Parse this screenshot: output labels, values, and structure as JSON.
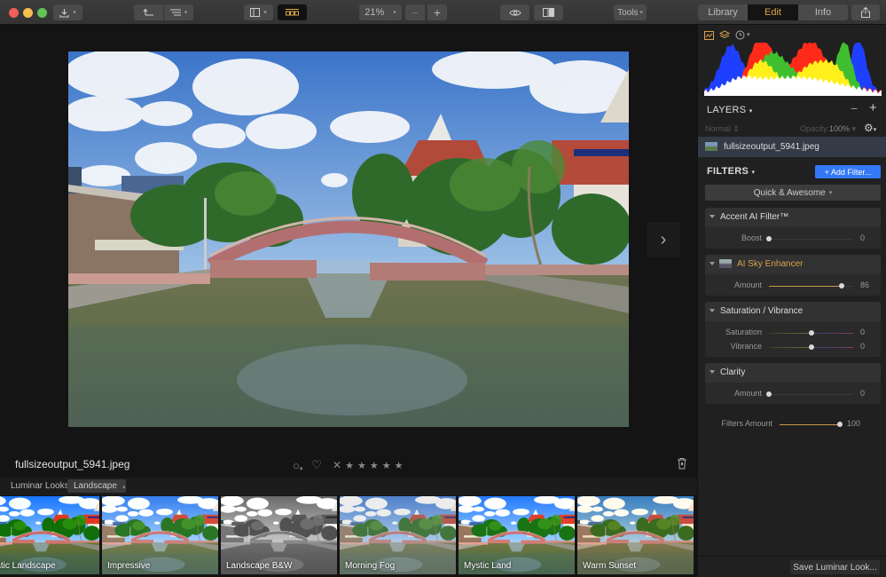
{
  "window": {
    "traffic_lights": [
      {
        "name": "close",
        "color": "#ed5f58"
      },
      {
        "name": "minimize",
        "color": "#f4bf4f"
      },
      {
        "name": "maximize",
        "color": "#60c454"
      }
    ]
  },
  "toolbar": {
    "export_icon": "download-icon",
    "undo_icon": "undo-icon",
    "list_icon": "list-icon",
    "sidebar_icon": "sidebar-icon",
    "filmstrip_icon": "filmstrip-icon",
    "zoom_value": "21%",
    "zoom_out_label": "−",
    "zoom_in_label": "+",
    "preview_icon": "eye-icon",
    "compare_icon": "compare-icon",
    "tools_label": "Tools",
    "tabs": [
      {
        "label": "Library",
        "active": false
      },
      {
        "label": "Edit",
        "active": true
      },
      {
        "label": "Info",
        "active": false
      }
    ],
    "share_icon": "share-icon"
  },
  "canvas": {
    "next_label": "›"
  },
  "infobar": {
    "filename": "fullsizeoutput_5941.jpeg",
    "stars": [
      "★",
      "★",
      "★",
      "★",
      "★"
    ],
    "reject_label": "✕",
    "heart_label": "♡",
    "circle_label": "○"
  },
  "looks": {
    "label": "Luminar Looks:",
    "selected": "Landscape",
    "items": [
      {
        "name": "Dramatic Landscape",
        "visible_label": "matic Landscape",
        "style": "dramatic"
      },
      {
        "name": "Impressive",
        "visible_label": "Impressive",
        "style": "impressive"
      },
      {
        "name": "Landscape B&W",
        "visible_label": "Landscape B&W",
        "style": "bw"
      },
      {
        "name": "Morning Fog",
        "visible_label": "Morning Fog",
        "style": "fog"
      },
      {
        "name": "Mystic Land",
        "visible_label": "Mystic Land",
        "style": "mystic"
      },
      {
        "name": "Warm Sunset",
        "visible_label": "Warm Sunset",
        "style": "warm"
      }
    ]
  },
  "panel": {
    "icons": [
      "histogram-icon",
      "layers-icon",
      "history-icon"
    ],
    "layers": {
      "title": "LAYERS",
      "minus": "−",
      "plus": "+",
      "blend_mode": "Normal",
      "opacity_label": "Opacity:",
      "opacity_value": "100%",
      "layer_name": "fullsizeoutput_5941.jpeg"
    },
    "filters": {
      "title": "FILTERS",
      "add_label": "+ Add Filter...",
      "preset_label": "Quick & Awesome",
      "accent": {
        "title": "Accent AI Filter™",
        "sliders": [
          {
            "label": "Boost",
            "value": 0,
            "fraction": 0.0
          }
        ]
      },
      "sky": {
        "title": "AI Sky Enhancer",
        "sliders": [
          {
            "label": "Amount",
            "value": 86,
            "fraction": 0.86
          }
        ]
      },
      "satvib": {
        "title": "Saturation / Vibrance",
        "sliders": [
          {
            "label": "Saturation",
            "value": 0,
            "fraction": 0.5
          },
          {
            "label": "Vibrance",
            "value": 0,
            "fraction": 0.5
          }
        ]
      },
      "clarity": {
        "title": "Clarity",
        "sliders": [
          {
            "label": "Amount",
            "value": 0,
            "fraction": 0.0
          }
        ]
      },
      "filters_amount": {
        "label": "Filters Amount",
        "value": 100,
        "fraction": 1.0
      }
    },
    "save_look_label": "Save Luminar Look...",
    "accent_color": "#d9a34a",
    "button_blue": "#3478f6"
  }
}
